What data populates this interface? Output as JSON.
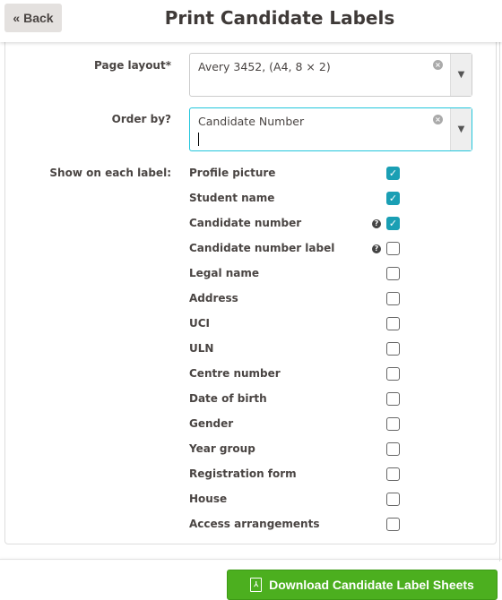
{
  "header": {
    "back_label": "« Back",
    "title": "Print Candidate Labels"
  },
  "form": {
    "page_layout": {
      "label": "Page layout*",
      "value": "Avery 3452, (A4, 8 × 2)"
    },
    "order_by": {
      "label": "Order by?",
      "value": "Candidate Number"
    },
    "show_label": "Show on each label:",
    "options": [
      {
        "label": "Profile picture",
        "checked": true,
        "help": false
      },
      {
        "label": "Student name",
        "checked": true,
        "help": false
      },
      {
        "label": "Candidate number",
        "checked": true,
        "help": true
      },
      {
        "label": "Candidate number label",
        "checked": false,
        "help": true
      },
      {
        "label": "Legal name",
        "checked": false,
        "help": false
      },
      {
        "label": "Address",
        "checked": false,
        "help": false
      },
      {
        "label": "UCI",
        "checked": false,
        "help": false
      },
      {
        "label": "ULN",
        "checked": false,
        "help": false
      },
      {
        "label": "Centre number",
        "checked": false,
        "help": false
      },
      {
        "label": "Date of birth",
        "checked": false,
        "help": false
      },
      {
        "label": "Gender",
        "checked": false,
        "help": false
      },
      {
        "label": "Year group",
        "checked": false,
        "help": false
      },
      {
        "label": "Registration form",
        "checked": false,
        "help": false
      },
      {
        "label": "House",
        "checked": false,
        "help": false
      },
      {
        "label": "Access arrangements",
        "checked": false,
        "help": false
      }
    ]
  },
  "footer": {
    "download_label": "Download Candidate Label Sheets"
  },
  "colors": {
    "accent": "#1a9fb4",
    "download": "#4caf1f",
    "focus": "#22c6dc"
  }
}
